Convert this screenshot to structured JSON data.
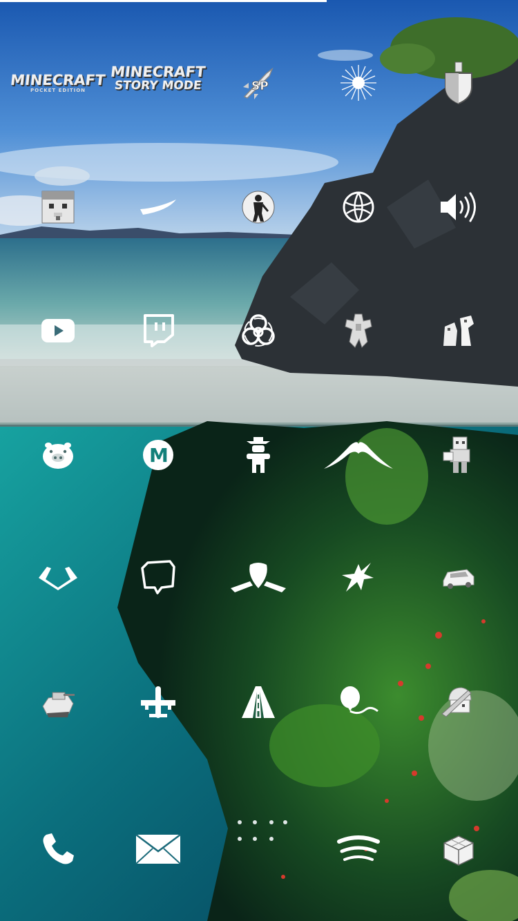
{
  "status_bar": {
    "progress_fraction": 0.63
  },
  "home_screen": {
    "rows": [
      [
        {
          "name": "minecraft-pocket-edition-app",
          "icon": "minecraft-pe-wordmark-icon",
          "line1": "MINECRAFT",
          "line2": "POCKET EDITION"
        },
        {
          "name": "minecraft-story-mode-app",
          "icon": "minecraft-story-mode-wordmark-icon",
          "line1": "MINECRAFT",
          "line2": "STORY MODE"
        },
        {
          "name": "sp-rocket-app",
          "icon": "rocket-sp-icon",
          "glyph": "SP"
        },
        {
          "name": "sunburst-app",
          "icon": "sunburst-icon"
        },
        {
          "name": "shield-app",
          "icon": "knight-shield-icon"
        }
      ],
      [
        {
          "name": "minecraft-block-head-app",
          "icon": "block-head-icon"
        },
        {
          "name": "slash-stroke-app",
          "icon": "brush-stroke-icon"
        },
        {
          "name": "slender-figure-app",
          "icon": "slender-figure-icon"
        },
        {
          "name": "basketball-app",
          "icon": "basketball-icon"
        },
        {
          "name": "volume-app",
          "icon": "speaker-volume-icon"
        }
      ],
      [
        {
          "name": "youtube-app",
          "icon": "youtube-play-icon"
        },
        {
          "name": "twitch-app",
          "icon": "twitch-icon"
        },
        {
          "name": "biohazard-app",
          "icon": "biohazard-icon"
        },
        {
          "name": "robot-mech-app",
          "icon": "mech-robot-icon"
        },
        {
          "name": "pixel-characters-app",
          "icon": "pixel-characters-icon"
        }
      ],
      [
        {
          "name": "angry-piggy-app",
          "icon": "pig-face-icon"
        },
        {
          "name": "mario-kart-app",
          "icon": "m-badge-icon",
          "glyph": "M"
        },
        {
          "name": "cowboy-robot-app",
          "icon": "cowboy-robot-icon"
        },
        {
          "name": "mustache-app",
          "icon": "mustache-icon"
        },
        {
          "name": "blocky-character-app",
          "icon": "blocky-character-icon"
        }
      ],
      [
        {
          "name": "winged-chevron-app",
          "icon": "winged-chevron-icon"
        },
        {
          "name": "speech-bubble-app",
          "icon": "speech-bubble-icon"
        },
        {
          "name": "bird-glider-app",
          "icon": "bird-glider-icon"
        },
        {
          "name": "jet-fighter-app",
          "icon": "jet-fighter-icon"
        },
        {
          "name": "sports-car-app",
          "icon": "car-icon"
        }
      ],
      [
        {
          "name": "tank-game-app",
          "icon": "tank-icon"
        },
        {
          "name": "airplane-app",
          "icon": "airplane-icon"
        },
        {
          "name": "highway-app",
          "icon": "road-lanes-icon"
        },
        {
          "name": "balloon-app",
          "icon": "balloon-icon"
        },
        {
          "name": "helmet-soldier-app",
          "icon": "soldier-helmet-icon"
        }
      ]
    ],
    "dock": [
      {
        "name": "phone-app",
        "icon": "phone-icon"
      },
      {
        "name": "mail-app",
        "icon": "envelope-icon"
      },
      {
        "name": "app-drawer",
        "icon": "app-drawer-dots-icon"
      },
      {
        "name": "spotify-app",
        "icon": "spotify-icon"
      },
      {
        "name": "package-app",
        "icon": "cube-boxes-icon"
      }
    ]
  },
  "wallpaper": {
    "description_colors": {
      "sky_top": "#1d5fb3",
      "sky_horizon": "#8fb7e0",
      "sea_surface": "#4aa3a8",
      "rock": "#2a2f33",
      "underwater": "#0f7f86",
      "reef": "#1f5a24"
    }
  }
}
